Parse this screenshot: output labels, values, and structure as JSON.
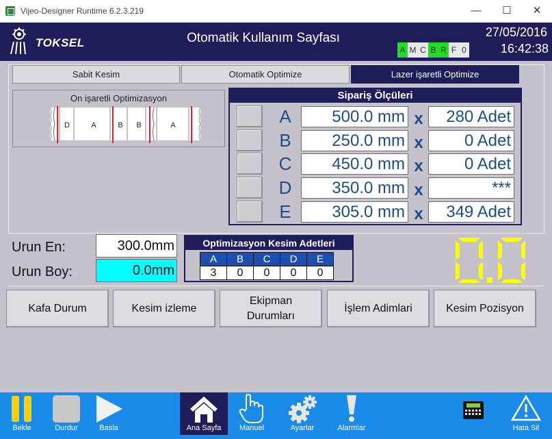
{
  "window": {
    "title": "Vijeo-Designer Runtime 6.2.3.219",
    "minimize": "—",
    "maximize": "☐",
    "close": "✕"
  },
  "header": {
    "brand": "TOKSEL",
    "title": "Otomatik Kullanım Sayfası",
    "date": "27/05/2016",
    "time": "16:42:38",
    "status": [
      {
        "label": "A",
        "on": true
      },
      {
        "label": "M",
        "on": false
      },
      {
        "label": "C",
        "on": false
      },
      {
        "label": "B",
        "on": true
      },
      {
        "label": "R",
        "on": true
      },
      {
        "label": "F",
        "on": false
      },
      {
        "label": "0",
        "on": false
      }
    ]
  },
  "tabs": [
    "Sabit Kesim",
    "Otomatik Optimize",
    "Lazer işaretli Optimize"
  ],
  "marker": {
    "title": "On işaretli Optimizasyon",
    "segments": [
      "D",
      "A",
      "B",
      "B",
      "A"
    ]
  },
  "order": {
    "title": "Sipariş Ölçüleri",
    "rows": [
      {
        "letter": "A",
        "length": "500.0 mm",
        "x": "x",
        "qty": "280 Adet"
      },
      {
        "letter": "B",
        "length": "250.0 mm",
        "x": "x",
        "qty": "0 Adet"
      },
      {
        "letter": "C",
        "length": "450.0 mm",
        "x": "x",
        "qty": "0 Adet"
      },
      {
        "letter": "D",
        "length": "350.0 mm",
        "x": "x",
        "qty": "***"
      },
      {
        "letter": "E",
        "length": "305.0 mm",
        "x": "x",
        "qty": "349 Adet"
      }
    ]
  },
  "product": {
    "width_label": "Urun En:",
    "width_value": "300.0mm",
    "length_label": "Urun Boy:",
    "length_value": "0.0mm"
  },
  "optimization": {
    "title": "Optimizasyon Kesim Adetleri",
    "headers": [
      "A",
      "B",
      "C",
      "D",
      "E"
    ],
    "values": [
      "3",
      "0",
      "0",
      "0",
      "0"
    ]
  },
  "big_display": "0.0",
  "actions": [
    "Kafa Durum",
    "Kesim izleme",
    "Ekipman Durumları",
    "İşlem Adimlari",
    "Kesim Pozisyon"
  ],
  "bottom": {
    "bekle": "Bekle",
    "durdur": "Durdur",
    "basla": "Basla",
    "ana_sayfa": "Ana Sayfa",
    "manuel": "Manuel",
    "ayarlar": "Ayarlar",
    "alarmlar": "Alarmlar",
    "hata_sil": "Hata Sil"
  },
  "colors": {
    "navy": "#1f1c5a",
    "bar": "#1a8be8",
    "value_blue": "#1e4e8a",
    "seg_yellow": "#ffff00",
    "cyan": "#00ffff"
  }
}
